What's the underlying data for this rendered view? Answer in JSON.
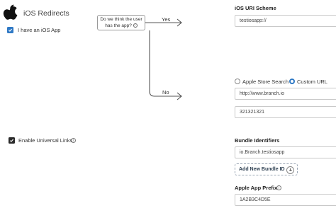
{
  "section": {
    "title": "iOS Redirects",
    "icon": "apple-logo-icon"
  },
  "have_ios_app": {
    "label": "I have an iOS App",
    "checked": true
  },
  "flow": {
    "question_line1": "Do we think the user",
    "question_line2": "has the app?",
    "yes_label": "Yes",
    "no_label": "No"
  },
  "uri_scheme": {
    "label": "iOS URI Scheme",
    "value": "testiosapp://"
  },
  "redirect_options": {
    "app_store_label": "Apple Store Search",
    "custom_url_label": "Custom URL",
    "selected": "Custom URL"
  },
  "custom_url": {
    "value": "http://www.branch.io"
  },
  "app_id": {
    "value": "321321321"
  },
  "universal_links": {
    "label": "Enable Universal Links",
    "checked": true
  },
  "bundle_identifiers": {
    "label": "Bundle Identifiers",
    "values": [
      "io.Branch.testiosapp"
    ],
    "add_label": "Add New Bundle ID"
  },
  "app_prefix": {
    "label": "Apple App Prefix",
    "value": "1A2B3C4D5E"
  },
  "colors": {
    "accent": "#2f79c5",
    "checkbox_dark": "#2b2b2b",
    "border": "#c9c9c9"
  }
}
